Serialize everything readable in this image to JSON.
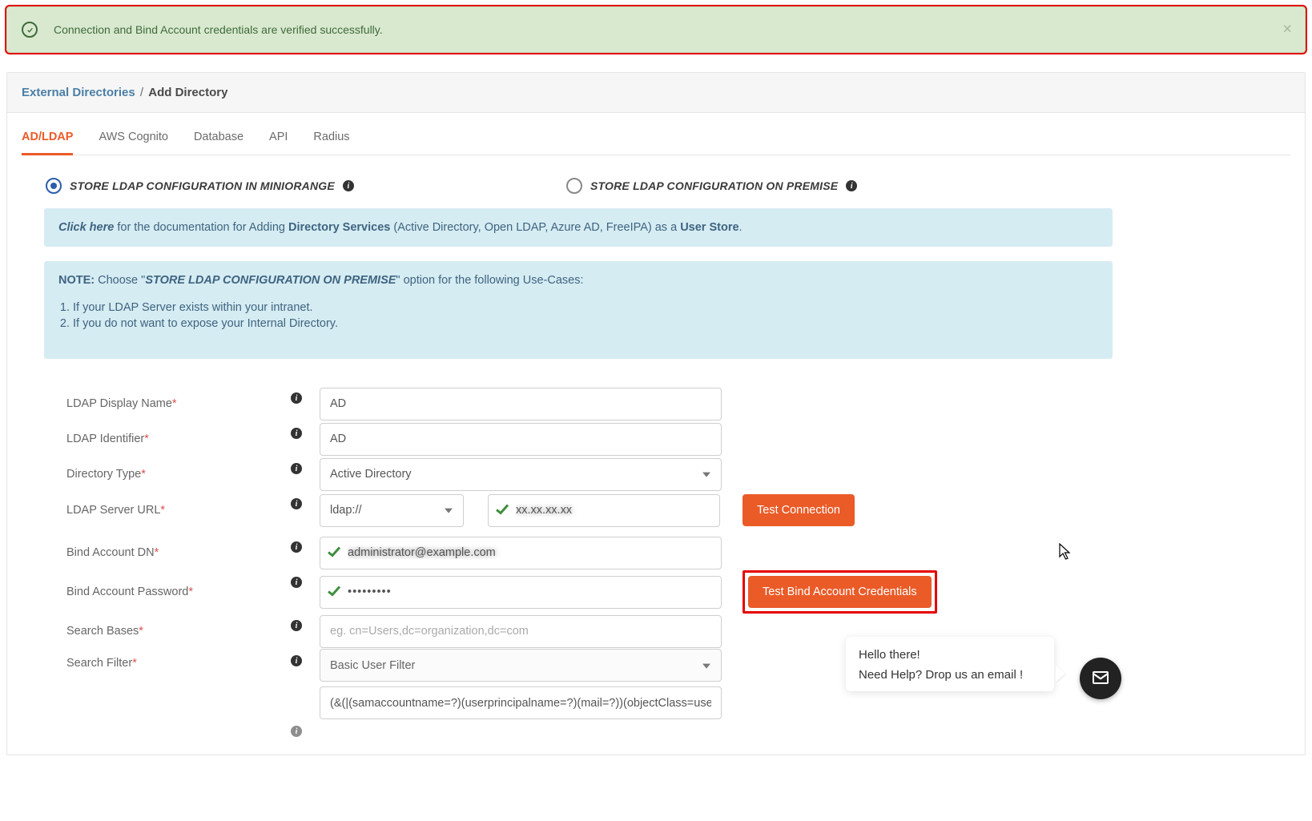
{
  "alert": {
    "text": "Connection and Bind Account credentials are verified successfully."
  },
  "breadcrumb": {
    "external_directories": "External Directories",
    "current": "Add Directory"
  },
  "tabs": [
    {
      "label": "AD/LDAP",
      "active": true
    },
    {
      "label": "AWS Cognito"
    },
    {
      "label": "Database"
    },
    {
      "label": "API"
    },
    {
      "label": "Radius"
    }
  ],
  "storage_options": {
    "miniorange": "STORE LDAP CONFIGURATION IN MINIORANGE",
    "on_premise": "STORE LDAP CONFIGURATION ON PREMISE"
  },
  "callout_doc": {
    "click_here": "Click here",
    "pre": " for the documentation for Adding ",
    "dir_services": "Directory Services",
    "paren": " (Active Directory, Open LDAP, Azure AD, FreeIPA) as a ",
    "user_store": "User Store",
    "dot": "."
  },
  "callout_note": {
    "note_label": "NOTE:",
    "choose": "  Choose ",
    "quote_open": "\"",
    "quote_text": "STORE LDAP CONFIGURATION ON PREMISE",
    "quote_close": "\"",
    "tail": " option for the following Use-Cases:",
    "items": [
      "If your LDAP Server exists within your intranet.",
      "If you do not want to expose your Internal Directory."
    ]
  },
  "form": {
    "display_name": {
      "label": "LDAP Display Name",
      "value": "AD"
    },
    "identifier": {
      "label": "LDAP Identifier",
      "value": "AD"
    },
    "dir_type": {
      "label": "Directory Type",
      "value": "Active Directory"
    },
    "server_url": {
      "label": "LDAP Server URL",
      "protocol": "ldap://",
      "value": "xx.xx.xx.xx"
    },
    "bind_dn": {
      "label": "Bind Account DN",
      "value": "administrator@example.com"
    },
    "bind_pw": {
      "label": "Bind Account Password",
      "value": "•••••••••"
    },
    "search_bases": {
      "label": "Search Bases",
      "placeholder": "eg. cn=Users,dc=organization,dc=com",
      "value": ""
    },
    "search_filter": {
      "label": "Search Filter",
      "type": "Basic User Filter",
      "expr": "(&(|(samaccountname=?)(userprincipalname=?)(mail=?))(objectClass=user))"
    }
  },
  "buttons": {
    "test_connection": "Test Connection",
    "test_bind": "Test Bind Account Credentials"
  },
  "chat": {
    "line1": "Hello there!",
    "line2": "Need Help? Drop us an email !"
  }
}
